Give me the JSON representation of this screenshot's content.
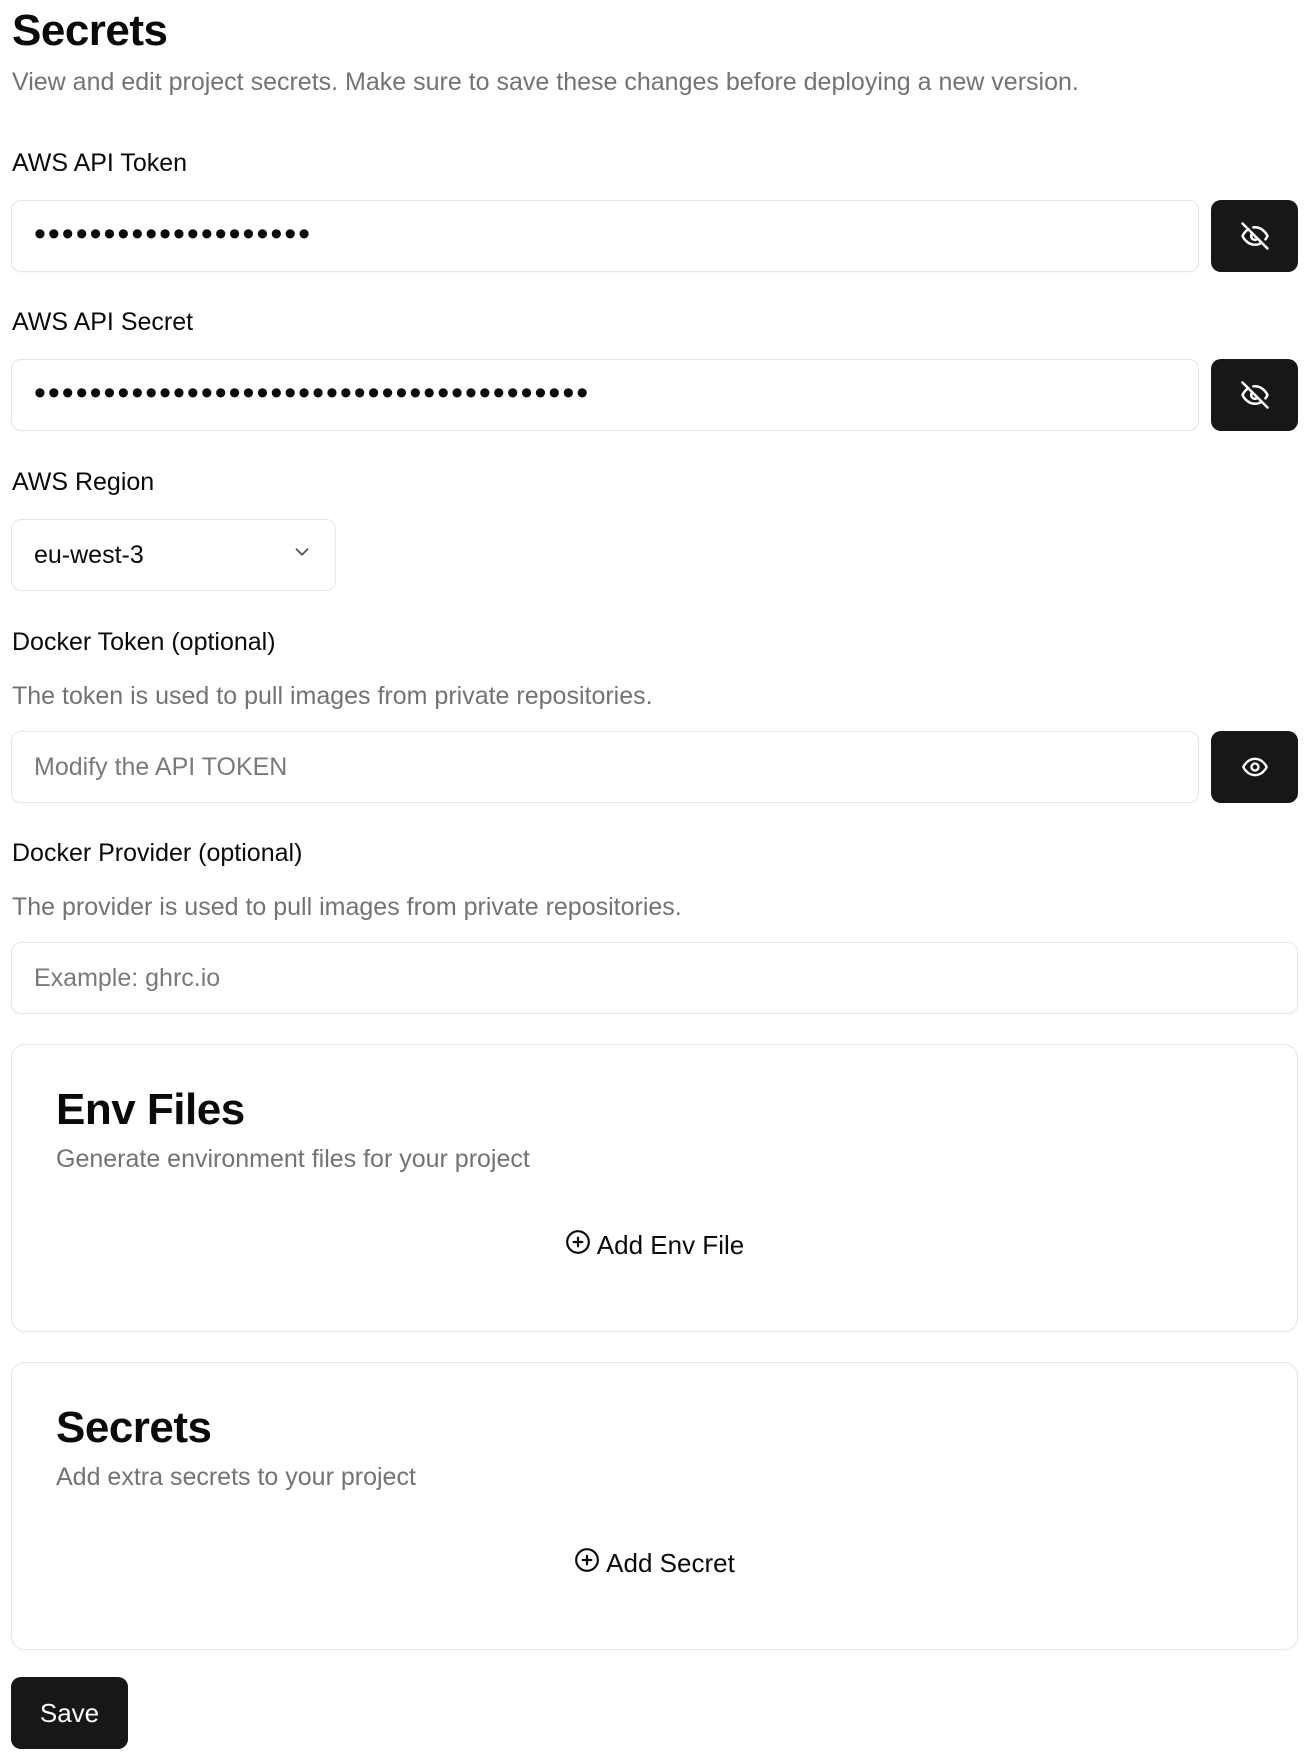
{
  "header": {
    "title": "Secrets",
    "description": "View and edit project secrets. Make sure to save these changes before deploying a new version."
  },
  "fields": {
    "aws_api_token": {
      "label": "AWS API Token",
      "value": "••••••••••••••••••••",
      "toggle_icon": "eye-off-icon"
    },
    "aws_api_secret": {
      "label": "AWS API Secret",
      "value": "••••••••••••••••••••••••••••••••••••••••",
      "toggle_icon": "eye-off-icon"
    },
    "aws_region": {
      "label": "AWS Region",
      "selected": "eu-west-3"
    },
    "docker_token": {
      "label": "Docker Token (optional)",
      "help": "The token is used to pull images from private repositories.",
      "placeholder": "Modify the API TOKEN",
      "value": "",
      "toggle_icon": "eye-icon"
    },
    "docker_provider": {
      "label": "Docker Provider (optional)",
      "help": "The provider is used to pull images from private repositories.",
      "placeholder": "Example: ghrc.io",
      "value": ""
    }
  },
  "env_files": {
    "title": "Env Files",
    "description": "Generate environment files for your project",
    "add_label": "Add Env File"
  },
  "secrets_card": {
    "title": "Secrets",
    "description": "Add extra secrets to your project",
    "add_label": "Add Secret"
  },
  "actions": {
    "save_label": "Save"
  },
  "colors": {
    "button_bg": "#171717",
    "border": "#e5e5e5",
    "muted_text": "#737373",
    "text": "#0a0a0a"
  }
}
